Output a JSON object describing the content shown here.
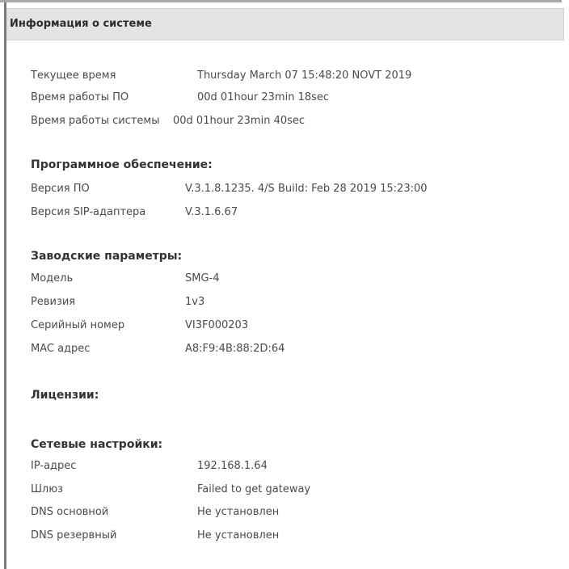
{
  "header": {
    "title": "Информация о системе"
  },
  "time": {
    "rows": [
      {
        "label": "Текущее время",
        "value": "Thursday March 07 15:48:20 NOVT 2019"
      },
      {
        "label": "Время работы ПО",
        "value": "00d 01hour 23min 18sec"
      },
      {
        "label": "Время работы системы",
        "value": "00d 01hour 23min 40sec"
      }
    ]
  },
  "software": {
    "title": "Программное обеспечение:",
    "rows": [
      {
        "label": "Версия ПО",
        "value": "V.3.1.8.1235. 4/S Build: Feb 28 2019 15:23:00"
      },
      {
        "label": "Версия SIP-адаптера",
        "value": "V.3.1.6.67"
      }
    ]
  },
  "factory": {
    "title": "Заводские параметры:",
    "rows": [
      {
        "label": "Модель",
        "value": "SMG-4"
      },
      {
        "label": "Ревизия",
        "value": "1v3"
      },
      {
        "label": "Серийный номер",
        "value": "VI3F000203"
      },
      {
        "label": "MAC адрес",
        "value": "A8:F9:4B:88:2D:64"
      }
    ]
  },
  "licenses": {
    "title": "Лицензии:"
  },
  "network": {
    "title": "Сетевые настройки:",
    "rows": [
      {
        "label": "IP-адрес",
        "value": "192.168.1.64"
      },
      {
        "label": "Шлюз",
        "value": "Failed to get gateway"
      },
      {
        "label": "DNS основной",
        "value": "Не установлен"
      },
      {
        "label": "DNS резервный",
        "value": "Не установлен"
      }
    ]
  }
}
